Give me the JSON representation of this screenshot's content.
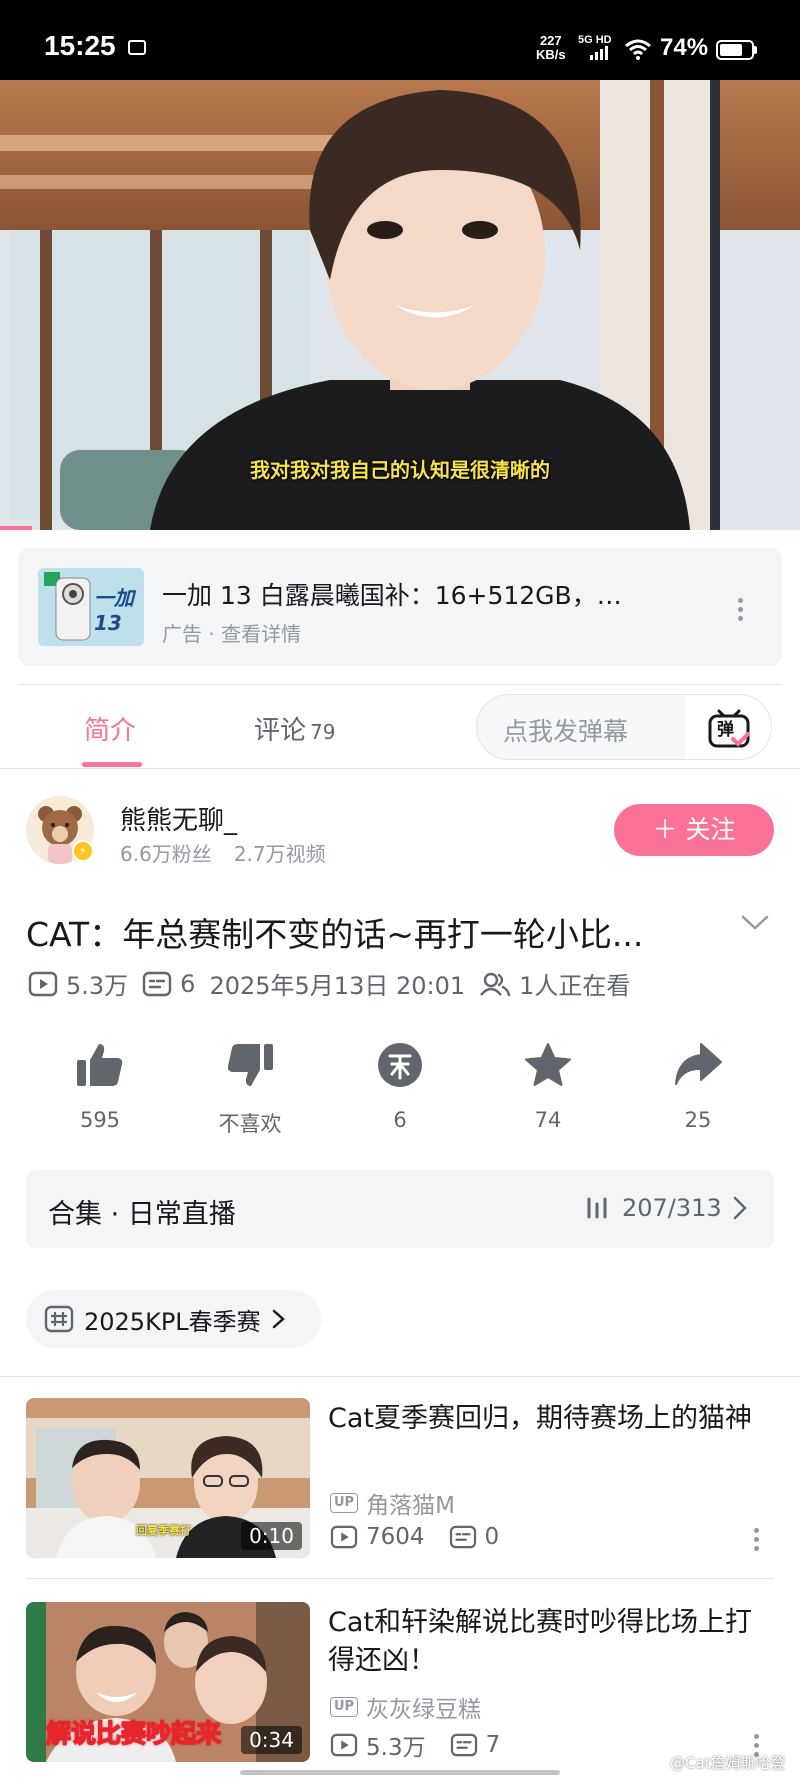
{
  "status_bar": {
    "time": "15:25",
    "net_speed_value": "227",
    "net_speed_unit": "KB/s",
    "network": "5G HD",
    "battery": "74%",
    "battery_level": 0.74
  },
  "player": {
    "subtitle": "我对我对我自己的认知是很清晰的",
    "progress": 0.04
  },
  "ad": {
    "thumb_text": "一加13",
    "title": "一加 13 白露晨曦国补：16+512GB，…",
    "subtitle": "广告 · 查看详情"
  },
  "tabs": {
    "intro": "简介",
    "comments": "评论",
    "comments_count": "79",
    "danmaku_placeholder": "点我发弹幕",
    "danmaku_button": "弹"
  },
  "uploader": {
    "name": "熊熊无聊_",
    "fans": "6.6万粉丝",
    "videos": "2.7万视频",
    "follow_label": "＋ 关注"
  },
  "video": {
    "title": "CAT：年总赛制不变的话~再打一轮小比...",
    "views": "5.3万",
    "danmaku_count": "6",
    "date": "2025年5月13日 20:01",
    "watching": "1人正在看"
  },
  "actions": {
    "like": "595",
    "dislike": "不喜欢",
    "coin": "6",
    "favorite": "74",
    "share": "25"
  },
  "collection": {
    "label": "合集 · 日常直播",
    "progress": "207/313"
  },
  "tag": {
    "label": "2025KPL春季赛"
  },
  "related": [
    {
      "title": "Cat夏季赛回归，期待赛场上的猫神",
      "duration": "0:10",
      "thumb_caption": "回夏季赛打",
      "author": "角落猫M",
      "views": "7604",
      "danmaku": "0"
    },
    {
      "title": "Cat和轩染解说比赛时吵得比场上打得还凶！",
      "duration": "0:34",
      "thumb_caption": "解说比赛吵起来",
      "author": "灰灰绿豆糕",
      "views": "5.3万",
      "danmaku": "7"
    }
  ],
  "watermark": "@Cat詹姆斯哈登"
}
